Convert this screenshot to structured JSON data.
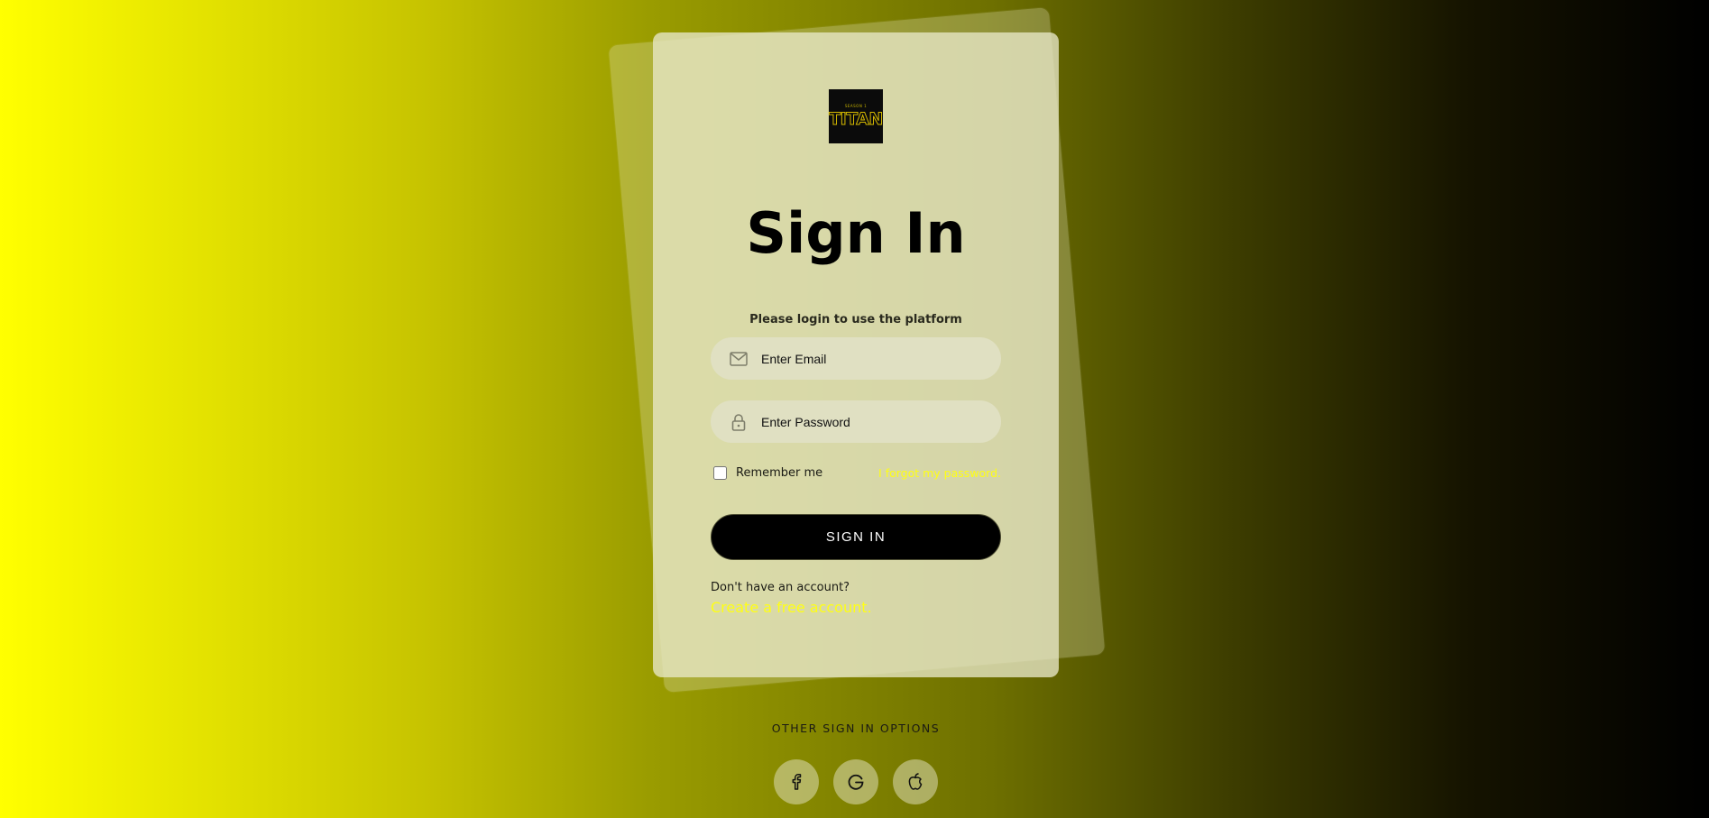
{
  "logo": {
    "small_text": "SEASON 1",
    "brand_text": "TITAN"
  },
  "form": {
    "title": "Sign In",
    "subtitle": "Please login to use the platform",
    "email_placeholder": "Enter Email",
    "password_placeholder": "Enter Password",
    "remember_label": "Remember me",
    "forgot_link": "I forgot my password.",
    "signin_button": "SIGN IN",
    "no_account_text": "Don't have an account?",
    "create_account_link": "Create a free account."
  },
  "other_options": {
    "label": "OTHER SIGN IN OPTIONS",
    "providers": [
      "facebook-icon",
      "google-icon",
      "apple-icon"
    ]
  },
  "colors": {
    "accent_link": "#ffff14",
    "button_bg": "#000000",
    "gradient_start": "#ffff00",
    "gradient_end": "#000000"
  }
}
